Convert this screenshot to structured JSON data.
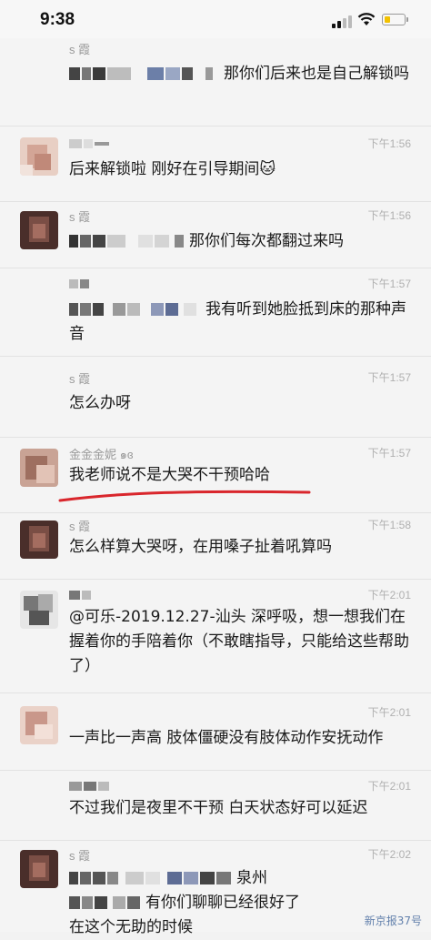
{
  "status_bar": {
    "time": "9:38"
  },
  "messages": [
    {
      "sender": "s 霞",
      "time": "",
      "text": "那你们后来也是自己解锁吗"
    },
    {
      "sender": "",
      "time": "下午1:56",
      "text": "后来解锁啦 刚好在引导期间🐱"
    },
    {
      "sender": "s 霞",
      "time": "下午1:56",
      "text": "那你们每次都翻过来吗"
    },
    {
      "sender": "",
      "time": "下午1:57",
      "text": "我有听到她脸抵到床的那种声音"
    },
    {
      "sender": "s 霞",
      "time": "下午1:57",
      "text": "怎么办呀"
    },
    {
      "sender": "金金金妮 ๑ɞ",
      "time": "下午1:57",
      "text": "我老师说不是大哭不干预哈哈"
    },
    {
      "sender": "s 霞",
      "time": "下午1:58",
      "text": "怎么样算大哭呀，在用嗓子扯着吼算吗"
    },
    {
      "sender": "",
      "time": "下午2:01",
      "text": "@可乐-2019.12.27-汕头 深呼吸，想一想我们在握着你的手陪着你（不敢瞎指导，只能给这些帮助了）"
    },
    {
      "sender": "",
      "time": "下午2:01",
      "text": "一声比一声高 肢体僵硬没有肢体动作安抚动作"
    },
    {
      "sender": "",
      "time": "下午2:01",
      "text": "不过我们是夜里不干预 白天状态好可以延迟"
    },
    {
      "sender": "s 霞",
      "time": "下午2:02",
      "text_part1": "泉州",
      "text_part2": "有你们聊聊已经很好了",
      "text_part3": "在这个无助的时候"
    }
  ],
  "watermark": "新京报37号",
  "colors": {
    "underline": "#d9262c",
    "background": "#f4f4f4"
  }
}
